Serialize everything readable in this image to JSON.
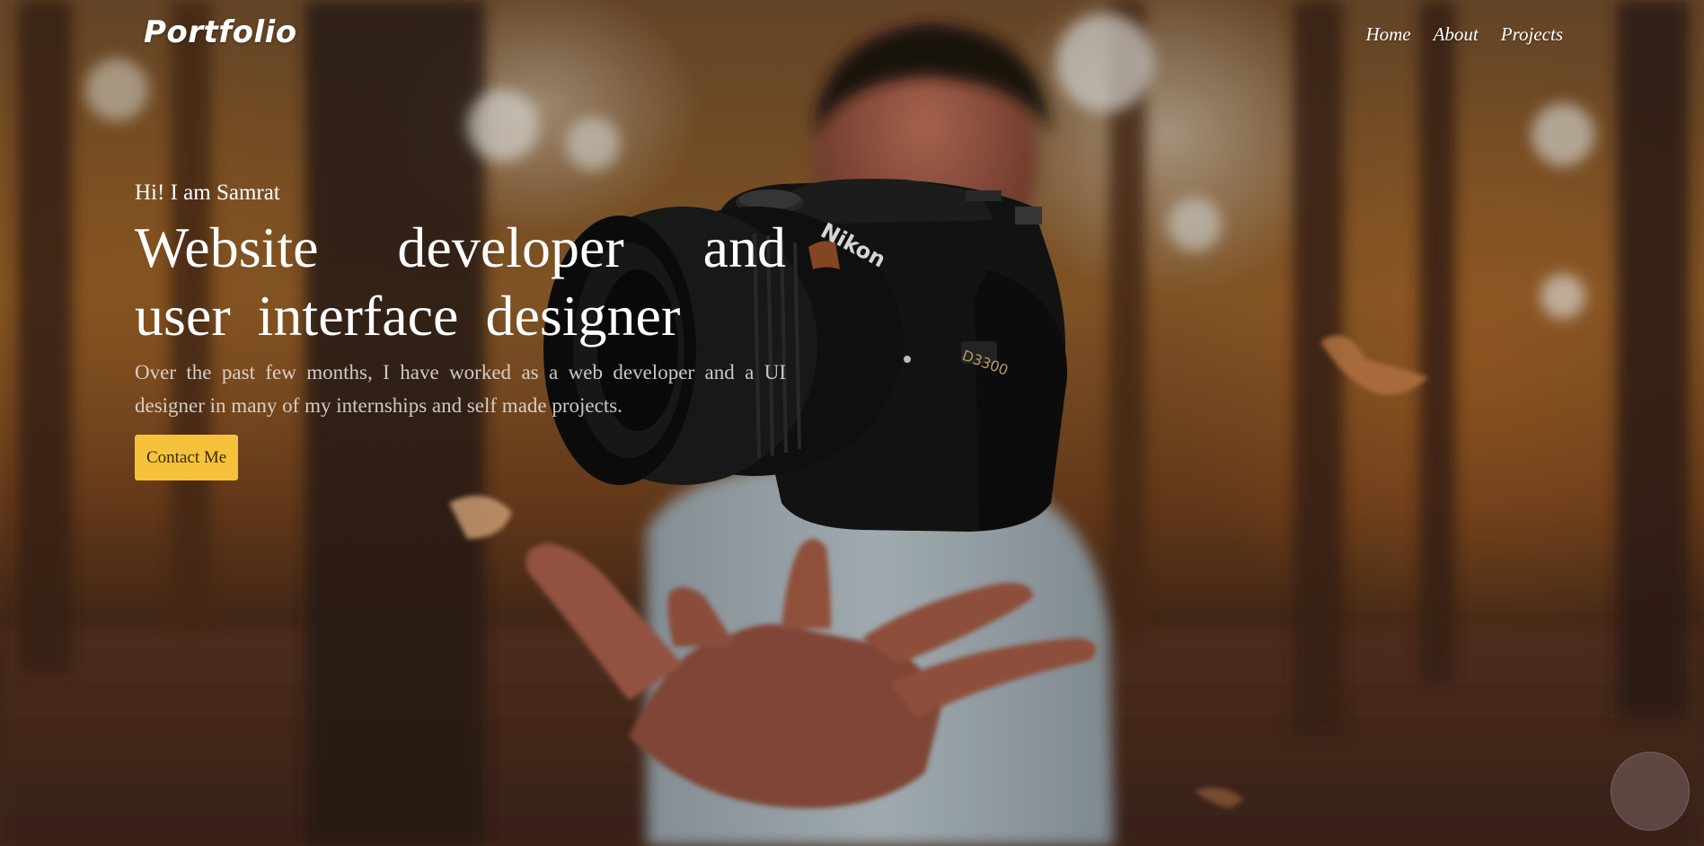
{
  "header": {
    "logo": "Portfolio",
    "nav": [
      {
        "label": "Home"
      },
      {
        "label": "About"
      },
      {
        "label": "Projects"
      }
    ]
  },
  "hero": {
    "greeting": "Hi! I am Samrat",
    "headline": "Website developer and user interface designer",
    "intro": "Over the past few months, I have worked as a web developer and a UI designer in many of my internships and self made projects.",
    "cta_label": "Contact Me"
  },
  "camera": {
    "brand": "Nikon",
    "model": "D3300"
  },
  "colors": {
    "accent": "#f6c23b",
    "text": "#ffffff"
  }
}
